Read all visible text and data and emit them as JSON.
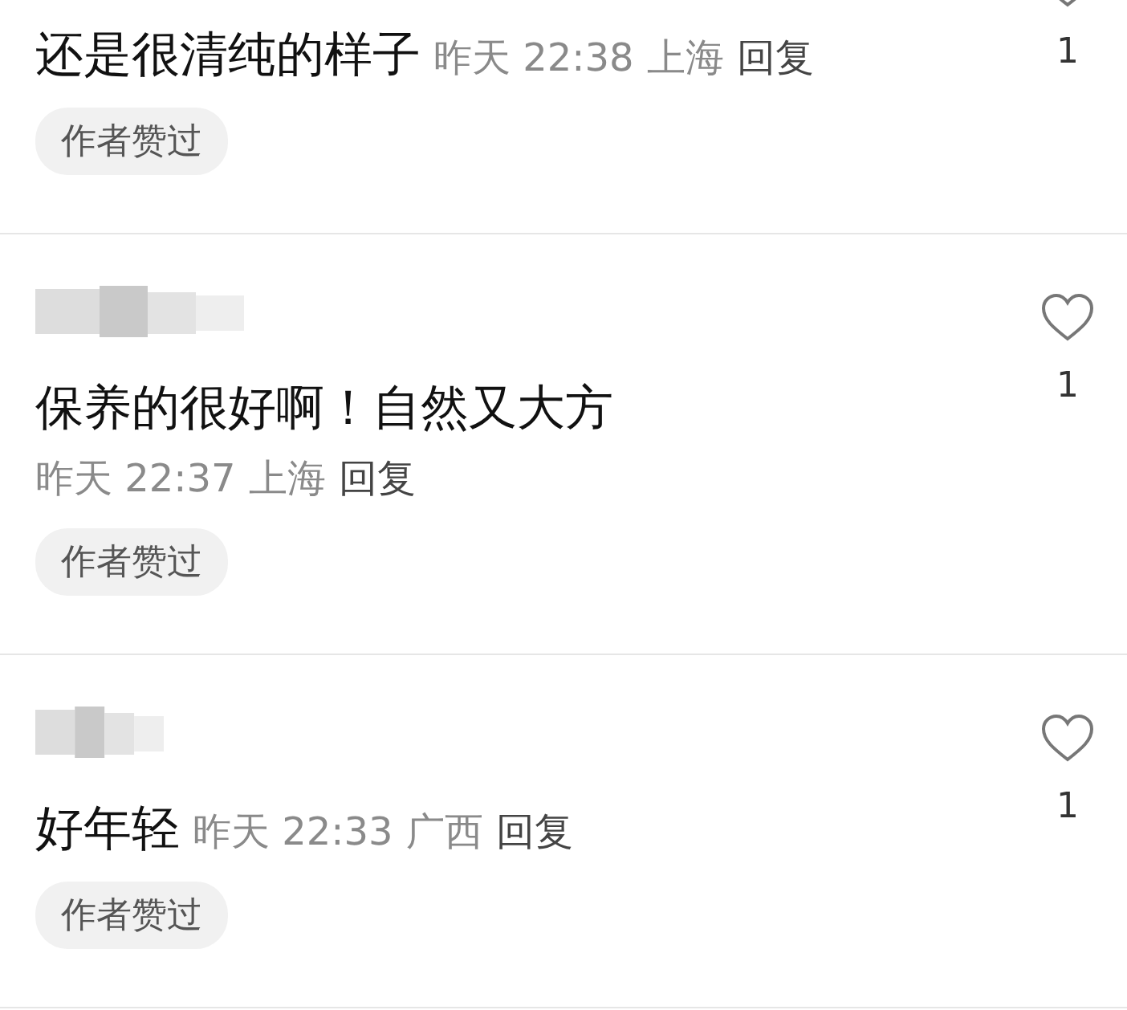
{
  "comments": [
    {
      "kind": "cut",
      "text": "还是很清纯的样子",
      "time": "昨天 22:38",
      "location": "上海",
      "reply": "回复",
      "badge": "作者赞过",
      "likes": "1"
    },
    {
      "kind": "full",
      "text": "保养的很好啊！自然又大方",
      "time": "昨天 22:37",
      "location": "上海",
      "reply": "回复",
      "badge": "作者赞过",
      "likes": "1"
    },
    {
      "kind": "full",
      "text": "好年轻",
      "time": "昨天 22:33",
      "location": "广西",
      "reply": "回复",
      "badge": "作者赞过",
      "likes": "1"
    }
  ]
}
